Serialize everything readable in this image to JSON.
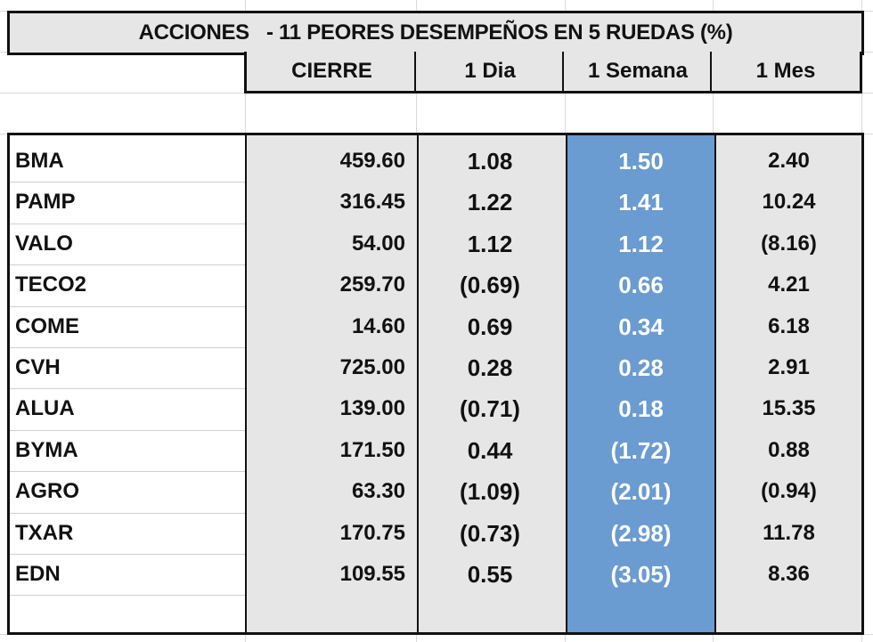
{
  "title": "ACCIONES   - 11 PEORES DESEMPEÑOS EN 5 RUEDAS (%)",
  "headers": {
    "cierre": "CIERRE",
    "dia": "1 Dia",
    "semana": "1 Semana",
    "mes": "1 Mes"
  },
  "colors": {
    "header_bg": "#e6e6e6",
    "highlight_column_bg": "#6a9bd1",
    "highlight_column_text": "#ffffff",
    "border": "#111111"
  },
  "rows": [
    {
      "ticker": "BMA",
      "cierre": "459.60",
      "dia": "1.08",
      "semana": "1.50",
      "mes": "2.40"
    },
    {
      "ticker": "PAMP",
      "cierre": "316.45",
      "dia": "1.22",
      "semana": "1.41",
      "mes": "10.24"
    },
    {
      "ticker": "VALO",
      "cierre": "54.00",
      "dia": "1.12",
      "semana": "1.12",
      "mes": "(8.16)"
    },
    {
      "ticker": "TECO2",
      "cierre": "259.70",
      "dia": "(0.69)",
      "semana": "0.66",
      "mes": "4.21"
    },
    {
      "ticker": "COME",
      "cierre": "14.60",
      "dia": "0.69",
      "semana": "0.34",
      "mes": "6.18"
    },
    {
      "ticker": "CVH",
      "cierre": "725.00",
      "dia": "0.28",
      "semana": "0.28",
      "mes": "2.91"
    },
    {
      "ticker": "ALUA",
      "cierre": "139.00",
      "dia": "(0.71)",
      "semana": "0.18",
      "mes": "15.35"
    },
    {
      "ticker": "BYMA",
      "cierre": "171.50",
      "dia": "0.44",
      "semana": "(1.72)",
      "mes": "0.88"
    },
    {
      "ticker": "AGRO",
      "cierre": "63.30",
      "dia": "(1.09)",
      "semana": "(2.01)",
      "mes": "(0.94)"
    },
    {
      "ticker": "TXAR",
      "cierre": "170.75",
      "dia": "(0.73)",
      "semana": "(2.98)",
      "mes": "11.78"
    },
    {
      "ticker": "EDN",
      "cierre": "109.55",
      "dia": "0.55",
      "semana": "(3.05)",
      "mes": "8.36"
    }
  ]
}
